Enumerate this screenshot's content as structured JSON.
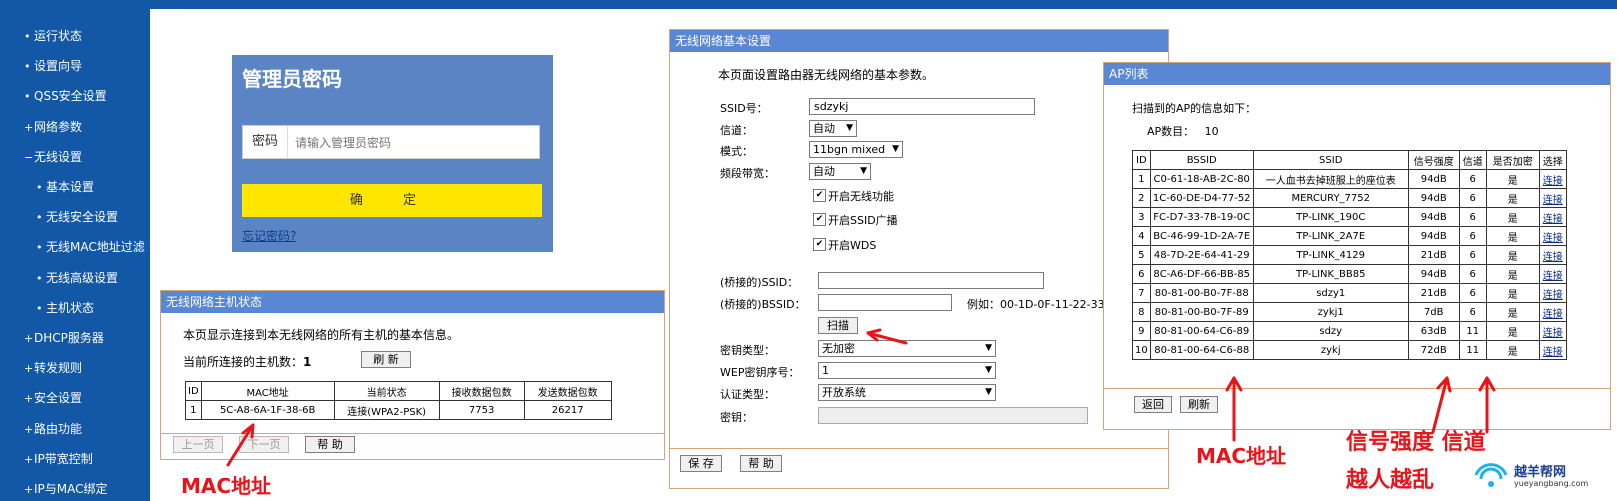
{
  "sidebar": {
    "items": [
      {
        "bullet": "•",
        "label": "运行状态"
      },
      {
        "bullet": "•",
        "label": "设置向导"
      },
      {
        "bullet": "•",
        "label": "QSS安全设置"
      },
      {
        "bullet": "+",
        "label": "网络参数"
      },
      {
        "bullet": "−",
        "label": "无线设置"
      },
      {
        "bullet": "•",
        "label": "基本设置"
      },
      {
        "bullet": "•",
        "label": "无线安全设置"
      },
      {
        "bullet": "•",
        "label": "无线MAC地址过滤"
      },
      {
        "bullet": "•",
        "label": "无线高级设置"
      },
      {
        "bullet": "•",
        "label": "主机状态"
      },
      {
        "bullet": "+",
        "label": "DHCP服务器"
      },
      {
        "bullet": "+",
        "label": "转发规则"
      },
      {
        "bullet": "+",
        "label": "安全设置"
      },
      {
        "bullet": "+",
        "label": "路由功能"
      },
      {
        "bullet": "+",
        "label": "IP带宽控制"
      },
      {
        "bullet": "+",
        "label": "IP与MAC绑定"
      }
    ]
  },
  "login": {
    "title": "管理员密码",
    "password_label": "密码",
    "password_placeholder": "请输入管理员密码",
    "confirm_label": "确 定",
    "forgot_label": "忘记密码?"
  },
  "host_status": {
    "title": "无线网络主机状态",
    "description": "本页显示连接到本无线网络的所有主机的基本信息。",
    "count_label": "当前所连接的主机数：",
    "count_value": "1",
    "refresh_label": "刷 新",
    "columns": [
      "ID",
      "MAC地址",
      "当前状态",
      "接收数据包数",
      "发送数据包数"
    ],
    "rows": [
      [
        "1",
        "5C-A8-6A-1F-38-6B",
        "连接(WPA2-PSK)",
        "7753",
        "26217"
      ]
    ],
    "prev_label": "上一页",
    "next_label": "下一页",
    "help_label": "帮 助"
  },
  "basic_settings": {
    "title": "无线网络基本设置",
    "description": "本页面设置路由器无线网络的基本参数。",
    "ssid_label": "SSID号：",
    "ssid_value": "sdzykj",
    "channel_label": "信道：",
    "channel_value": "自动",
    "mode_label": "模式：",
    "mode_value": "11bgn mixed",
    "bandwidth_label": "频段带宽：",
    "bandwidth_value": "自动",
    "enable_wireless": "开启无线功能",
    "enable_ssid_broadcast": "开启SSID广播",
    "enable_wds": "开启WDS",
    "bridge_ssid_label": "(桥接的)SSID：",
    "bridge_bssid_label": "(桥接的)BSSID：",
    "bssid_example": "例如：00-1D-0F-11-22-33",
    "scan_label": "扫描",
    "key_type_label": "密钥类型：",
    "key_type_value": "无加密",
    "wep_index_label": "WEP密钥序号：",
    "wep_index_value": "1",
    "auth_type_label": "认证类型：",
    "auth_type_value": "开放系统",
    "key_label": "密钥：",
    "save_label": "保 存",
    "help_label": "帮 助"
  },
  "ap_list": {
    "title": "AP列表",
    "description": "扫描到的AP的信息如下：",
    "count_label": "AP数目：",
    "count_value": "10",
    "columns": [
      "ID",
      "BSSID",
      "SSID",
      "信号强度",
      "信道",
      "是否加密",
      "选择"
    ],
    "rows": [
      [
        "1",
        "C0-61-18-AB-2C-80",
        "一人血书去掉班服上的座位表",
        "94dB",
        "6",
        "是",
        "连接"
      ],
      [
        "2",
        "1C-60-DE-D4-77-52",
        "MERCURY_7752",
        "94dB",
        "6",
        "是",
        "连接"
      ],
      [
        "3",
        "FC-D7-33-7B-19-0C",
        "TP-LINK_190C",
        "94dB",
        "6",
        "是",
        "连接"
      ],
      [
        "4",
        "BC-46-99-1D-2A-7E",
        "TP-LINK_2A7E",
        "94dB",
        "6",
        "是",
        "连接"
      ],
      [
        "5",
        "48-7D-2E-64-41-29",
        "TP-LINK_4129",
        "21dB",
        "6",
        "是",
        "连接"
      ],
      [
        "6",
        "8C-A6-DF-66-BB-85",
        "TP-LINK_BB85",
        "94dB",
        "6",
        "是",
        "连接"
      ],
      [
        "7",
        "80-81-00-B0-7F-88",
        "sdzy1",
        "21dB",
        "6",
        "是",
        "连接"
      ],
      [
        "8",
        "80-81-00-B0-7F-89",
        "zykj1",
        "7dB",
        "6",
        "是",
        "连接"
      ],
      [
        "9",
        "80-81-00-64-C6-89",
        "sdzy",
        "63dB",
        "11",
        "是",
        "连接"
      ],
      [
        "10",
        "80-81-00-64-C6-88",
        "zykj",
        "72dB",
        "11",
        "是",
        "连接"
      ]
    ],
    "back_label": "返回",
    "refresh_label": "刷新"
  },
  "annotations": {
    "mac_left": "MAC地址",
    "mac_right": "MAC地址",
    "signal_channel": "信号强度 信道",
    "bottom_text": "越人越乱"
  },
  "watermark": {
    "text": "越羊帮网",
    "url": "yueyangbang.com"
  }
}
